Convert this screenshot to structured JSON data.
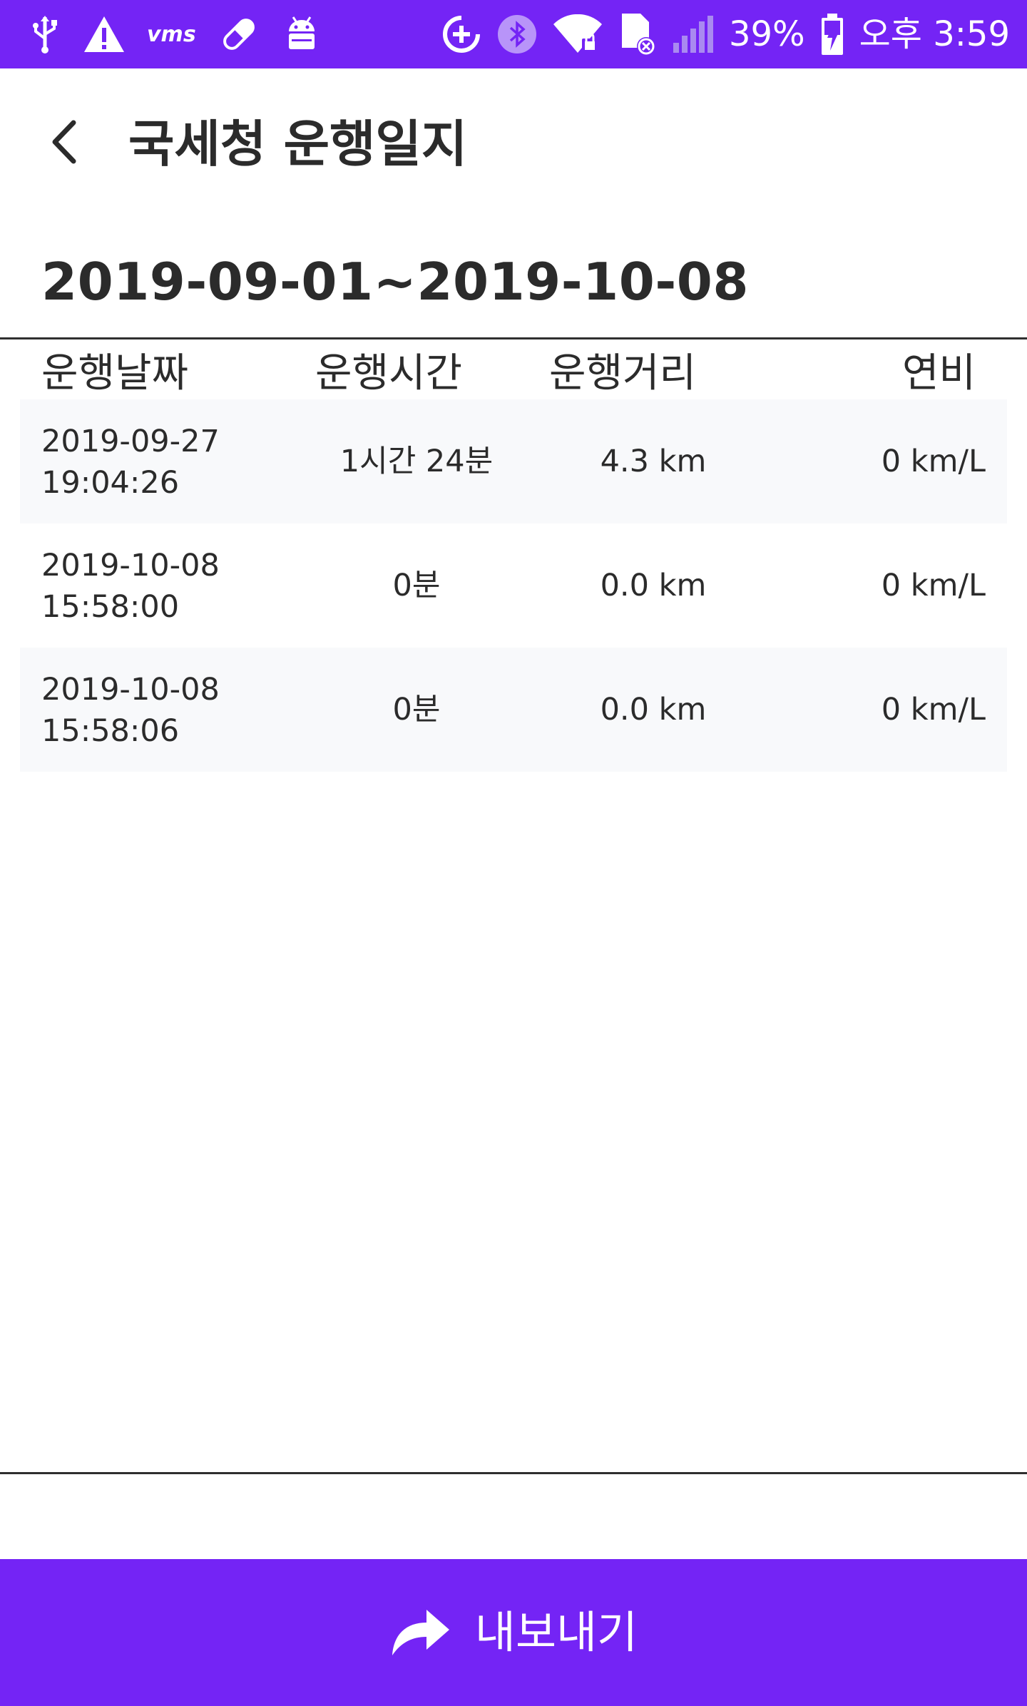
{
  "status_bar": {
    "vms": "vms",
    "battery": "39%",
    "time": "오후 3:59",
    "icons_left": [
      "usb-icon",
      "warning-icon",
      "vms-icon",
      "pill-icon",
      "android-icon"
    ],
    "icons_right": [
      "data-saver-icon",
      "bluetooth-icon",
      "wifi-lock-icon",
      "sim-error-icon",
      "signal-icon",
      "battery-charging-icon"
    ]
  },
  "header": {
    "back_icon": "chevron-left-icon",
    "title": "국세청 운행일지"
  },
  "date_range": "2019-09-01~2019-10-08",
  "table": {
    "columns": [
      "운행날짜",
      "운행시간",
      "운행거리",
      "연비"
    ],
    "rows": [
      {
        "date": "2019-09-27",
        "clock": "19:04:26",
        "duration": "1시간 24분",
        "distance": "4.3 km",
        "efficiency": "0 km/L"
      },
      {
        "date": "2019-10-08",
        "clock": "15:58:00",
        "duration": "0분",
        "distance": "0.0 km",
        "efficiency": "0 km/L"
      },
      {
        "date": "2019-10-08",
        "clock": "15:58:06",
        "duration": "0분",
        "distance": "0.0 km",
        "efficiency": "0 km/L"
      }
    ]
  },
  "export": {
    "label": "내보내기",
    "icon": "share-arrow-icon"
  },
  "colors": {
    "primary": "#7424f5",
    "text": "#2b2b2b",
    "row_alt": "#f8f9fb",
    "white": "#ffffff"
  }
}
